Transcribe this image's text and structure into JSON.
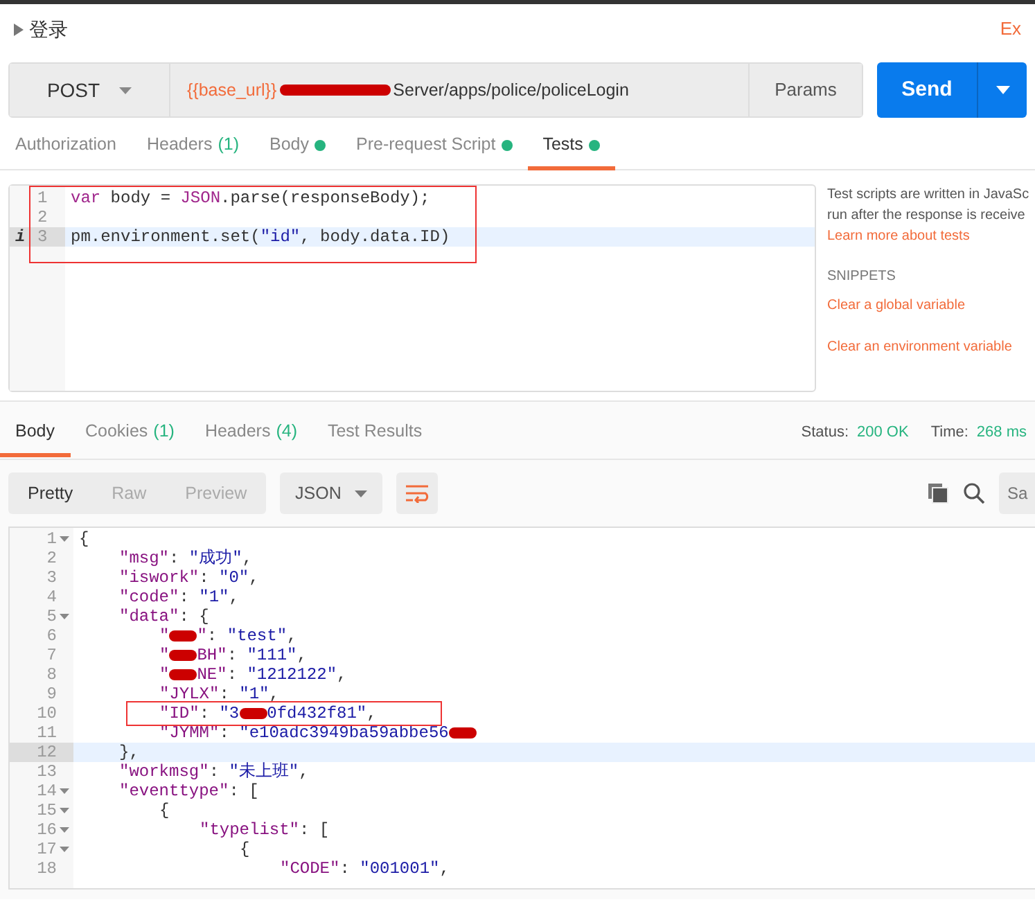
{
  "request": {
    "name": "登录",
    "export_link": "Ex",
    "method": "POST",
    "url_variable": "{{base_url}}",
    "url_rest": "Server/apps/police/policeLogin",
    "params_label": "Params",
    "send_label": "Send"
  },
  "request_tabs": [
    {
      "label": "Authorization",
      "selected": false
    },
    {
      "label": "Headers",
      "count": "(1)",
      "selected": false
    },
    {
      "label": "Body",
      "dot": true,
      "selected": false
    },
    {
      "label": "Pre-request Script",
      "dot": true,
      "selected": false
    },
    {
      "label": "Tests",
      "dot": true,
      "selected": true
    }
  ],
  "editor_lines": [
    {
      "number": "1",
      "active": false,
      "tokens": [
        {
          "kind": "keyword",
          "t": "var"
        },
        {
          "kind": "plain",
          "t": " body = "
        },
        {
          "kind": "keyword",
          "t": "JSON"
        },
        {
          "kind": "plain",
          "t": ".parse(responseBody);"
        }
      ]
    },
    {
      "number": "2",
      "active": false
    },
    {
      "number": "3",
      "active": true,
      "marker": "i",
      "tokens": [
        {
          "kind": "plain",
          "t": "pm.environment.set("
        },
        {
          "kind": "string",
          "t": "\"id\""
        },
        {
          "kind": "plain",
          "t": ", body.data.ID)"
        }
      ]
    }
  ],
  "side_panel": {
    "intro_lines": [
      "Test scripts are written in JavaSc",
      "run after the response is receive"
    ],
    "learn_link": "Learn more about tests",
    "snippets_heading": "SNIPPETS",
    "snippets": [
      "Clear a global variable",
      "Clear an environment variable"
    ]
  },
  "response_tabs": [
    {
      "label": "Body",
      "selected": true
    },
    {
      "label": "Cookies",
      "count": "(1)",
      "selected": false
    },
    {
      "label": "Headers",
      "count": "(4)",
      "selected": false
    },
    {
      "label": "Test Results",
      "selected": false
    }
  ],
  "status": {
    "status_label": "Status:",
    "status_value": "200 OK",
    "time_label": "Time:",
    "time_value": "268 ms"
  },
  "view_modes": [
    {
      "label": "Pretty",
      "selected": true
    },
    {
      "label": "Raw",
      "selected": false
    },
    {
      "label": "Preview",
      "selected": false
    }
  ],
  "format": "JSON",
  "search_placeholder": "Sa",
  "body_lines": [
    {
      "number": "1",
      "fold": true,
      "active": false,
      "tokens": [
        {
          "kind": "plain",
          "t": "{"
        }
      ],
      "children": [
        {
          "number": "2",
          "fold": false,
          "active": false,
          "tokens": [
            {
              "kind": "key",
              "t": "\"msg\""
            },
            {
              "kind": "plain",
              "t": ": "
            },
            {
              "kind": "string",
              "t": "\"成功\""
            },
            {
              "kind": "plain",
              "t": ","
            }
          ]
        },
        {
          "number": "3",
          "fold": false,
          "active": false,
          "tokens": [
            {
              "kind": "key",
              "t": "\"iswork\""
            },
            {
              "kind": "plain",
              "t": ": "
            },
            {
              "kind": "string",
              "t": "\"0\""
            },
            {
              "kind": "plain",
              "t": ","
            }
          ]
        },
        {
          "number": "4",
          "fold": false,
          "active": false,
          "tokens": [
            {
              "kind": "key",
              "t": "\"code\""
            },
            {
              "kind": "plain",
              "t": ": "
            },
            {
              "kind": "string",
              "t": "\"1\""
            },
            {
              "kind": "plain",
              "t": ","
            }
          ]
        },
        {
          "number": "5",
          "fold": true,
          "active": false,
          "tokens": [
            {
              "kind": "key",
              "t": "\"data\""
            },
            {
              "kind": "plain",
              "t": ": {"
            }
          ],
          "children": [
            {
              "number": "6",
              "fold": false,
              "active": false,
              "tokens": [
                {
                  "kind": "key",
                  "t": "\""
                },
                {
                  "kind": "redaction"
                },
                {
                  "kind": "key",
                  "t": "\""
                },
                {
                  "kind": "plain",
                  "t": ": "
                },
                {
                  "kind": "string",
                  "t": "\"test\""
                },
                {
                  "kind": "plain",
                  "t": ","
                }
              ]
            },
            {
              "number": "7",
              "fold": false,
              "active": false,
              "tokens": [
                {
                  "kind": "key",
                  "t": "\""
                },
                {
                  "kind": "redaction"
                },
                {
                  "kind": "key",
                  "t": "BH\""
                },
                {
                  "kind": "plain",
                  "t": ": "
                },
                {
                  "kind": "string",
                  "t": "\"111\""
                },
                {
                  "kind": "plain",
                  "t": ","
                }
              ]
            },
            {
              "number": "8",
              "fold": false,
              "active": false,
              "tokens": [
                {
                  "kind": "key",
                  "t": "\""
                },
                {
                  "kind": "redaction"
                },
                {
                  "kind": "key",
                  "t": "NE\""
                },
                {
                  "kind": "plain",
                  "t": ": "
                },
                {
                  "kind": "string",
                  "t": "\"1212122\""
                },
                {
                  "kind": "plain",
                  "t": ","
                }
              ]
            },
            {
              "number": "9",
              "fold": false,
              "active": false,
              "tokens": [
                {
                  "kind": "key",
                  "t": "\"JYLX\""
                },
                {
                  "kind": "plain",
                  "t": ": "
                },
                {
                  "kind": "string",
                  "t": "\"1\""
                },
                {
                  "kind": "plain",
                  "t": ","
                }
              ]
            },
            {
              "number": "10",
              "fold": false,
              "active": false,
              "boxed": true,
              "tokens": [
                {
                  "kind": "key",
                  "t": "\"ID\""
                },
                {
                  "kind": "plain",
                  "t": ": "
                },
                {
                  "kind": "string",
                  "t": "\"3"
                },
                {
                  "kind": "redaction"
                },
                {
                  "kind": "string",
                  "t": "0fd432f81\""
                },
                {
                  "kind": "plain",
                  "t": ","
                }
              ]
            },
            {
              "number": "11",
              "fold": false,
              "active": false,
              "tokens": [
                {
                  "kind": "key",
                  "t": "\"JYMM\""
                },
                {
                  "kind": "plain",
                  "t": ": "
                },
                {
                  "kind": "string",
                  "t": "\"e10adc3949ba59abbe56"
                },
                {
                  "kind": "redaction"
                }
              ]
            }
          ]
        },
        {
          "number": "12",
          "fold": false,
          "active": true,
          "tokens": [
            {
              "kind": "plain",
              "t": "},"
            }
          ]
        },
        {
          "number": "13",
          "fold": false,
          "active": false,
          "tokens": [
            {
              "kind": "key",
              "t": "\"workmsg\""
            },
            {
              "kind": "plain",
              "t": ": "
            },
            {
              "kind": "string",
              "t": "\"未上班\""
            },
            {
              "kind": "plain",
              "t": ","
            }
          ]
        },
        {
          "number": "14",
          "fold": true,
          "active": false,
          "tokens": [
            {
              "kind": "key",
              "t": "\"eventtype\""
            },
            {
              "kind": "plain",
              "t": ": ["
            }
          ],
          "children": [
            {
              "number": "15",
              "fold": true,
              "active": false,
              "tokens": [
                {
                  "kind": "plain",
                  "t": "{"
                }
              ],
              "children": [
                {
                  "number": "16",
                  "fold": true,
                  "active": false,
                  "tokens": [
                    {
                      "kind": "key",
                      "t": "\"typelist\""
                    },
                    {
                      "kind": "plain",
                      "t": ": ["
                    }
                  ],
                  "children": [
                    {
                      "number": "17",
                      "fold": true,
                      "active": false,
                      "tokens": [
                        {
                          "kind": "plain",
                          "t": "{"
                        }
                      ],
                      "children": [
                        {
                          "number": "18",
                          "fold": false,
                          "active": false,
                          "tokens": [
                            {
                              "kind": "key",
                              "t": "\"CODE\""
                            },
                            {
                              "kind": "plain",
                              "t": ": "
                            },
                            {
                              "kind": "string",
                              "t": "\"001001\""
                            },
                            {
                              "kind": "plain",
                              "t": ","
                            }
                          ]
                        }
                      ]
                    }
                  ]
                }
              ]
            }
          ]
        }
      ]
    }
  ]
}
